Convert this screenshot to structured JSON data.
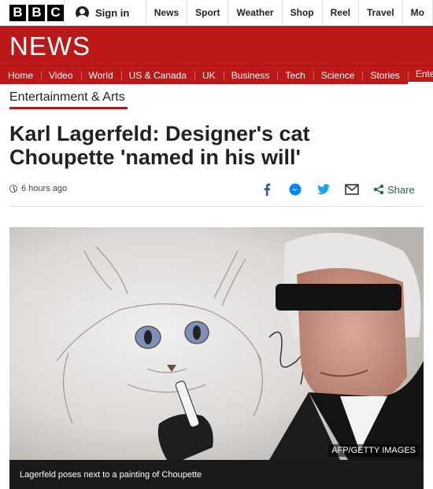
{
  "header": {
    "logo_letters": [
      "B",
      "B",
      "C"
    ],
    "signin_label": "Sign in",
    "top_nav": [
      "News",
      "Sport",
      "Weather",
      "Shop",
      "Reel",
      "Travel",
      "Mo"
    ]
  },
  "news_banner": {
    "title": "NEWS"
  },
  "section_nav": [
    "Home",
    "Video",
    "World",
    "US & Canada",
    "UK",
    "Business",
    "Tech",
    "Science",
    "Stories",
    "Enterta"
  ],
  "section_label": "Entertainment & Arts",
  "headline": "Karl Lagerfeld: Designer's cat Choupette 'named in his will'",
  "timestamp": "6 hours ago",
  "share": {
    "label": "Share",
    "icons": [
      "facebook-icon",
      "messenger-icon",
      "twitter-icon",
      "email-icon",
      "share-icon"
    ]
  },
  "image": {
    "credit": "AFP/GETTY IMAGES",
    "caption": "Lagerfeld poses next to a painting of Choupette"
  },
  "colors": {
    "brand_red": "#bb1919",
    "share_green": "#1e6a4f",
    "facebook_blue": "#3b5998",
    "messenger_blue": "#0084ff",
    "twitter_blue": "#1da1f2"
  }
}
